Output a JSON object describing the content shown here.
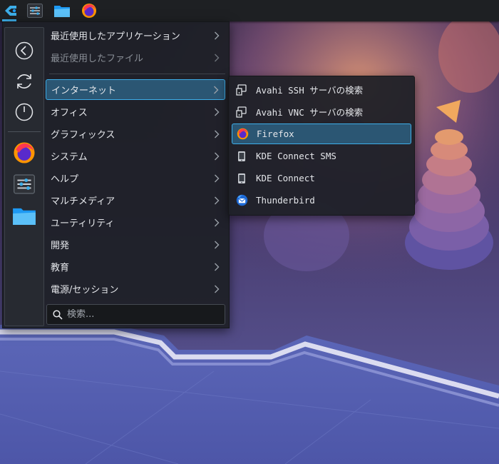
{
  "panel": {
    "items": [
      {
        "icon": "kde-logo-icon"
      },
      {
        "icon": "system-settings-icon"
      },
      {
        "icon": "file-manager-icon"
      },
      {
        "icon": "firefox-icon"
      }
    ]
  },
  "favorites": [
    {
      "icon": "back-arrow-icon"
    },
    {
      "icon": "restart-icon"
    },
    {
      "icon": "power-icon"
    },
    {
      "icon": "firefox-icon"
    },
    {
      "icon": "system-settings-icon"
    },
    {
      "icon": "file-manager-icon"
    }
  ],
  "categories": [
    {
      "label": "最近使用したアプリケーション"
    },
    {
      "label": "最近使用したファイル"
    },
    {
      "label": "インターネット"
    },
    {
      "label": "オフィス"
    },
    {
      "label": "グラフィックス"
    },
    {
      "label": "システム"
    },
    {
      "label": "ヘルプ"
    },
    {
      "label": "マルチメディア"
    },
    {
      "label": "ユーティリティ"
    },
    {
      "label": "開発"
    },
    {
      "label": "教育"
    },
    {
      "label": "電源/セッション"
    }
  ],
  "search": {
    "placeholder": "検索..."
  },
  "submenu": {
    "items": [
      {
        "label": "Avahi SSH サーバの検索",
        "icon": "network-search-icon"
      },
      {
        "label": "Avahi VNC サーバの検索",
        "icon": "network-search-icon"
      },
      {
        "label": "Firefox",
        "icon": "firefox-icon"
      },
      {
        "label": "KDE Connect SMS",
        "icon": "kdeconnect-icon"
      },
      {
        "label": "KDE Connect",
        "icon": "kdeconnect-icon"
      },
      {
        "label": "Thunderbird",
        "icon": "thunderbird-icon"
      }
    ]
  },
  "colors": {
    "accent": "#3daee9",
    "highlight": "#2b5673",
    "panel": "#1e2023"
  }
}
